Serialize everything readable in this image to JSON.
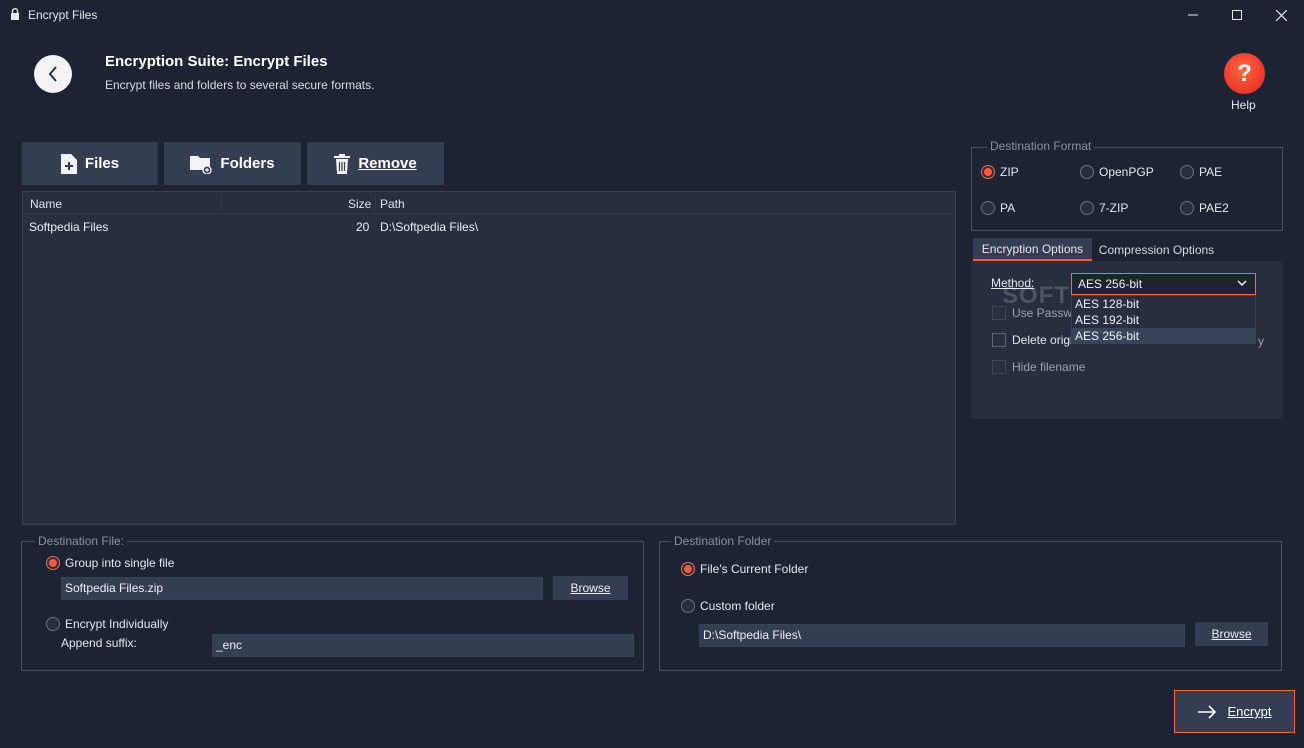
{
  "window": {
    "title": "Encrypt Files",
    "controls": {
      "minimize": "—",
      "maximize": "☐",
      "close": "✕"
    }
  },
  "header": {
    "title": "Encryption Suite: Encrypt Files",
    "subtitle": "Encrypt files and folders to several secure formats.",
    "help_label": "Help",
    "help_glyph": "?"
  },
  "toolbar": {
    "files_label": "Files",
    "folders_label": "Folders",
    "remove_label": "Remove"
  },
  "file_list": {
    "columns": [
      "Name",
      "Size",
      "Path"
    ],
    "rows": [
      {
        "name": "Softpedia Files",
        "size": "20",
        "path": "D:\\Softpedia Files\\"
      }
    ]
  },
  "destination_format": {
    "legend": "Destination Format",
    "options": [
      "ZIP",
      "OpenPGP",
      "PAE",
      "PA",
      "7-ZIP",
      "PAE2"
    ],
    "selected": "ZIP"
  },
  "tabs": {
    "encryption": "Encryption Options",
    "compression": "Compression Options",
    "active": "Encryption Options"
  },
  "encryption_options": {
    "method_label": "Method:",
    "method_value": "AES 256-bit",
    "method_options": [
      "AES 128-bit",
      "AES 192-bit",
      "AES 256-bit"
    ],
    "use_password_label": "Use Passwo",
    "delete_original_label": "Delete origi",
    "delete_original_tail": "y",
    "hide_filename_label": "Hide filename"
  },
  "watermark": "SOFTPEDIA",
  "destination_file": {
    "legend": "Destination File:",
    "group_label": "Group into single file",
    "group_selected": true,
    "filename_value": "Softpedia Files.zip",
    "browse_label": "Browse",
    "individual_label": "Encrypt Individually",
    "suffix_label": "Append suffix:",
    "suffix_value": "_enc"
  },
  "destination_folder": {
    "legend": "Destination Folder",
    "current_label": "File's Current Folder",
    "current_selected": true,
    "custom_label": "Custom folder",
    "custom_value": "D:\\Softpedia Files\\",
    "browse_label": "Browse"
  },
  "encrypt_label": "Encrypt",
  "colors": {
    "background": "#1c2333",
    "panel": "#262e40",
    "button": "#343d51",
    "accent": "#ff5a3c"
  }
}
